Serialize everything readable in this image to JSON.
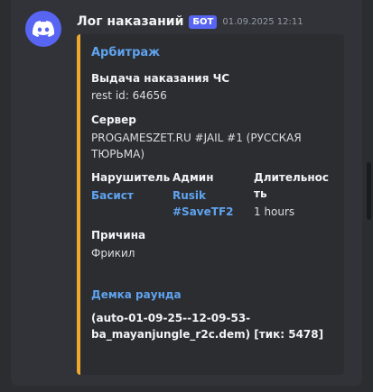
{
  "message": {
    "author": "Лог наказаний",
    "bot_tag": "БОТ",
    "timestamp": "01.09.2025 12:11",
    "avatar_icon": "discord-logo-icon"
  },
  "embed": {
    "accent_color": "#f0a82c",
    "author_link": "Арбитраж",
    "title": "Выдача наказания ЧС",
    "rest_id": "rest id: 64656",
    "server_label": "Сервер",
    "server_value_line1": "PROGAMESZET.RU #JAIL #1 (РУССКАЯ",
    "server_value_line2": "ТЮРЬМА)",
    "fields": {
      "violator_label": "Нарушитель",
      "violator_value": "Басист",
      "admin_label": "Админ",
      "admin_value_line1": "Rusik",
      "admin_value_line2": "#SaveTF2",
      "duration_label_line1": "Длительнос",
      "duration_label_line2": "ть",
      "duration_value": "1 hours"
    },
    "reason_label": "Причина",
    "reason_value": "Фрикил",
    "demo_link": "Демка раунда",
    "demo_line1": "(auto-01-09-25--12-09-53-",
    "demo_line2": "ba_mayanjungle_r2c.dem) [тик: 5478]"
  }
}
